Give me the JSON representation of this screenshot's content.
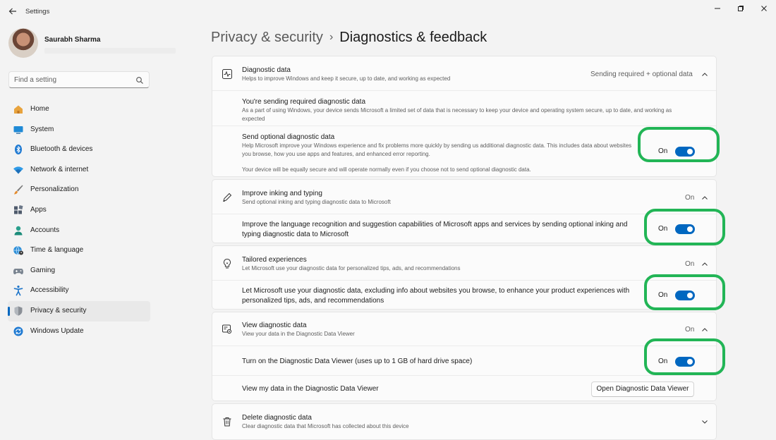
{
  "window": {
    "title": "Settings"
  },
  "user": {
    "name": "Saurabh Sharma"
  },
  "search": {
    "placeholder": "Find a setting"
  },
  "sidebar": {
    "items": [
      {
        "label": "Home",
        "icon": "home-icon"
      },
      {
        "label": "System",
        "icon": "system-icon"
      },
      {
        "label": "Bluetooth & devices",
        "icon": "bluetooth-icon"
      },
      {
        "label": "Network & internet",
        "icon": "wifi-icon"
      },
      {
        "label": "Personalization",
        "icon": "brush-icon"
      },
      {
        "label": "Apps",
        "icon": "apps-icon"
      },
      {
        "label": "Accounts",
        "icon": "accounts-icon"
      },
      {
        "label": "Time & language",
        "icon": "globe-clock-icon"
      },
      {
        "label": "Gaming",
        "icon": "gamepad-icon"
      },
      {
        "label": "Accessibility",
        "icon": "accessibility-icon"
      },
      {
        "label": "Privacy & security",
        "icon": "shield-icon",
        "active": true
      },
      {
        "label": "Windows Update",
        "icon": "update-icon"
      }
    ]
  },
  "header": {
    "parent": "Privacy & security",
    "separator": "›",
    "current": "Diagnostics & feedback"
  },
  "diagnostic": {
    "title": "Diagnostic data",
    "desc": "Helps to improve Windows and keep it secure, up to date, and working as expected",
    "status": "Sending required + optional data",
    "required_title": "You're sending required diagnostic data",
    "required_desc": "As a part of using Windows, your device sends Microsoft a limited set of data that is necessary to keep your device and operating system secure, up to date, and working as expected",
    "optional_title": "Send optional diagnostic data",
    "optional_desc": "Help Microsoft improve your Windows experience and fix problems more quickly by sending us additional diagnostic data. This includes data about websites you browse, how you use apps and features, and enhanced error reporting.",
    "optional_note": "Your device will be equally secure and will operate normally even if you choose not to send optional diagnostic data.",
    "optional_toggle": "On"
  },
  "inking": {
    "title": "Improve inking and typing",
    "desc": "Send optional inking and typing diagnostic data to Microsoft",
    "status": "On",
    "sub_text": "Improve the language recognition and suggestion capabilities of Microsoft apps and services by sending optional inking and typing diagnostic data to Microsoft",
    "toggle": "On"
  },
  "tailored": {
    "title": "Tailored experiences",
    "desc": "Let Microsoft use your diagnostic data for personalized tips, ads, and recommendations",
    "status": "On",
    "sub_text": "Let Microsoft use your diagnostic data, excluding info about websites you browse, to enhance your product experiences with personalized tips, ads, and recommendations",
    "toggle": "On"
  },
  "viewer": {
    "title": "View diagnostic data",
    "desc": "View your data in the Diagnostic Data Viewer",
    "status": "On",
    "turn_on_text": "Turn on the Diagnostic Data Viewer (uses up to 1 GB of hard drive space)",
    "toggle": "On",
    "view_text": "View my data in the Diagnostic Data Viewer",
    "open_button": "Open Diagnostic Data Viewer"
  },
  "delete": {
    "title": "Delete diagnostic data",
    "desc": "Clear diagnostic data that Microsoft has collected about this device"
  },
  "colors": {
    "accent": "#0067c0",
    "highlight": "#22b556"
  }
}
